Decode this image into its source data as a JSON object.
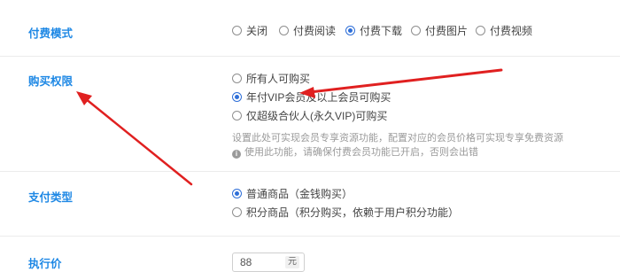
{
  "pay_mode": {
    "label": "付费模式",
    "options": [
      {
        "label": "关闭",
        "selected": false
      },
      {
        "label": "付费阅读",
        "selected": false
      },
      {
        "label": "付费下载",
        "selected": true
      },
      {
        "label": "付费图片",
        "selected": false
      },
      {
        "label": "付费视频",
        "selected": false
      }
    ]
  },
  "purchase_permission": {
    "label": "购买权限",
    "options": [
      {
        "label": "所有人可购买",
        "selected": false
      },
      {
        "label": "年付VIP会员及以上会员可购买",
        "selected": true
      },
      {
        "label": "仅超级合伙人(永久VIP)可购买",
        "selected": false
      }
    ],
    "help_text": "设置此处可实现会员专享资源功能，配置对应的会员价格可实现专享免费资源",
    "warning_text": "使用此功能，请确保付费会员功能已开启，否则会出错"
  },
  "payment_type": {
    "label": "支付类型",
    "options": [
      {
        "label": "普通商品（金钱购买）",
        "selected": true
      },
      {
        "label": "积分商品（积分购买，依赖于用户积分功能）",
        "selected": false
      }
    ]
  },
  "execution_price": {
    "label": "执行价",
    "value": "88",
    "unit": "元"
  },
  "colors": {
    "label_blue": "#1e88e5",
    "radio_selected": "#2f6fd8",
    "annotation_red": "#e02020"
  },
  "icons": {
    "info": "info-circle-icon",
    "annotation": "red-arrow-annotation"
  }
}
